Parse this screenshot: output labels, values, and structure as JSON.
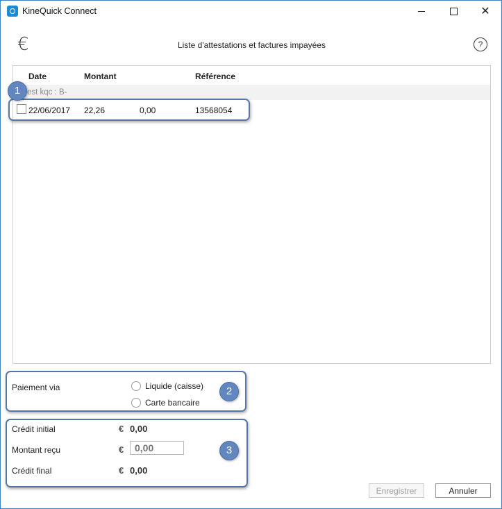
{
  "window": {
    "title": "KineQuick Connect",
    "minimize": "—",
    "maximize": "□",
    "close": "✕"
  },
  "header": {
    "currency_symbol": "€",
    "title": "Liste d'attestations et factures impayées",
    "help": "?"
  },
  "table": {
    "columns": {
      "date": "Date",
      "amount": "Montant",
      "reference": "Référence"
    },
    "group_label": "est kqc :  B-",
    "rows": [
      {
        "checked": false,
        "date": "22/06/2017",
        "amount": "22,26",
        "paid": "0,00",
        "reference": "13568054"
      }
    ]
  },
  "payment": {
    "label": "Paiement via",
    "options": [
      "Liquide (caisse)",
      "Carte bancaire"
    ]
  },
  "credit": {
    "initial_label": "Crédit initial",
    "initial_value": "0,00",
    "received_label": "Montant reçu",
    "received_placeholder": "0,00",
    "final_label": "Crédit final",
    "final_value": "0,00",
    "currency": "€"
  },
  "buttons": {
    "save": "Enregistrer",
    "cancel": "Annuler"
  },
  "callouts": [
    "1",
    "2",
    "3"
  ],
  "colors": {
    "callout_border": "#5577a8",
    "badge": "#6287c0",
    "app_icon": "#1a8ad4"
  }
}
